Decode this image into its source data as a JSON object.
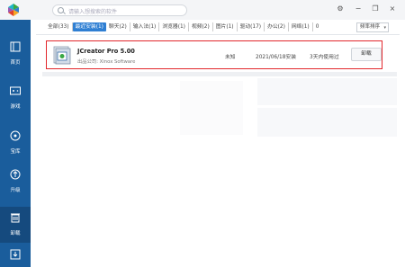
{
  "search": {
    "placeholder": "请输入想搜索的软件"
  },
  "window": {
    "minimize": "−",
    "maximize": "❐",
    "close": "×",
    "settings": "⚙"
  },
  "sidebar": {
    "items": [
      {
        "label": "首页",
        "icon": "home-icon"
      },
      {
        "label": "游戏",
        "icon": "gamepad-icon"
      },
      {
        "label": "宝库",
        "icon": "treasure-icon"
      },
      {
        "label": "升级",
        "icon": "upgrade-icon"
      },
      {
        "label": "卸载",
        "icon": "trash-icon",
        "active": true
      },
      {
        "label": "",
        "icon": "download-icon"
      }
    ]
  },
  "tabs": [
    "全部(33)",
    "最近安装(1)",
    "聊天(2)",
    "输入法(1)",
    "浏览器(1)",
    "视频(2)",
    "图片(1)",
    "驱动(17)",
    "办公(2)",
    "网络(1)",
    "0"
  ],
  "sort": {
    "label": "频率排序",
    "caret": "▾"
  },
  "app": {
    "name": "JCreator Pro 5.00",
    "publisher": "出品公司: Xinox Software",
    "size": "未知",
    "installed": "2021/06/18安装",
    "usage": "3天内使用过",
    "uninstall": "卸载"
  },
  "colors": {
    "sidebar": "#1a5d9c",
    "accent": "#2f7fd3",
    "highlight": "#e2272c"
  }
}
